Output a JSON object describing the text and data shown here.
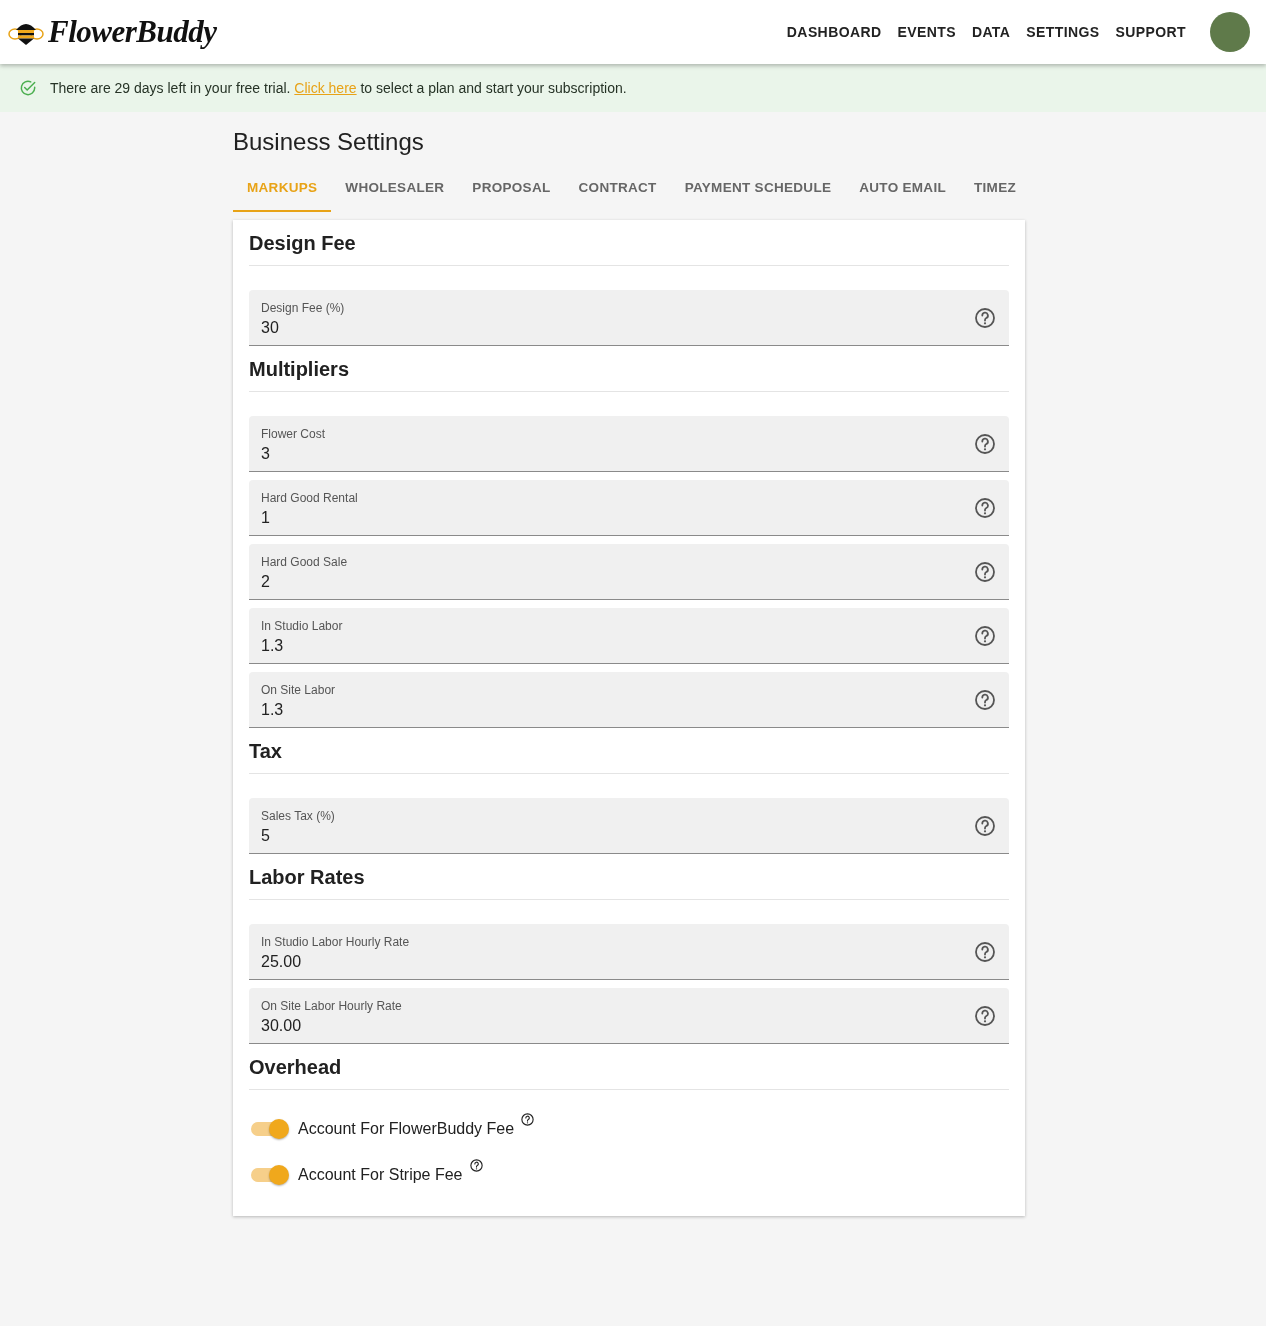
{
  "header": {
    "logo": "FlowerBuddy",
    "nav": [
      {
        "label": "DASHBOARD"
      },
      {
        "label": "EVENTS"
      },
      {
        "label": "DATA"
      },
      {
        "label": "SETTINGS"
      },
      {
        "label": "SUPPORT"
      }
    ]
  },
  "banner": {
    "before": "There are 29 days left in your free trial. ",
    "link": "Click here",
    "after": " to select a plan and start your subscription."
  },
  "page_title": "Business Settings",
  "tabs": [
    {
      "label": "MARKUPS",
      "selected": true
    },
    {
      "label": "WHOLESALER",
      "selected": false
    },
    {
      "label": "PROPOSAL",
      "selected": false
    },
    {
      "label": "CONTRACT",
      "selected": false
    },
    {
      "label": "PAYMENT SCHEDULE",
      "selected": false
    },
    {
      "label": "AUTO EMAIL",
      "selected": false
    },
    {
      "label": "TIMEZ",
      "selected": false
    }
  ],
  "sections": [
    {
      "title": "Design Fee",
      "items": [
        {
          "kind": "field",
          "label": "Design Fee (%)",
          "value": "30"
        }
      ]
    },
    {
      "title": "Multipliers",
      "items": [
        {
          "kind": "field",
          "label": "Flower Cost",
          "value": "3"
        },
        {
          "kind": "field",
          "label": "Hard Good Rental",
          "value": "1"
        },
        {
          "kind": "field",
          "label": "Hard Good Sale",
          "value": "2"
        },
        {
          "kind": "field",
          "label": "In Studio Labor",
          "value": "1.3"
        },
        {
          "kind": "field",
          "label": "On Site Labor",
          "value": "1.3"
        }
      ]
    },
    {
      "title": "Tax",
      "items": [
        {
          "kind": "field",
          "label": "Sales Tax (%)",
          "value": "5"
        }
      ]
    },
    {
      "title": "Labor Rates",
      "items": [
        {
          "kind": "field",
          "label": "In Studio Labor Hourly Rate",
          "value": "25.00"
        },
        {
          "kind": "field",
          "label": "On Site Labor Hourly Rate",
          "value": "30.00"
        }
      ]
    },
    {
      "title": "Overhead",
      "items": [
        {
          "kind": "toggle",
          "label": "Account For FlowerBuddy Fee",
          "on": true
        },
        {
          "kind": "toggle",
          "label": "Account For Stripe Fee",
          "on": true
        }
      ]
    }
  ]
}
